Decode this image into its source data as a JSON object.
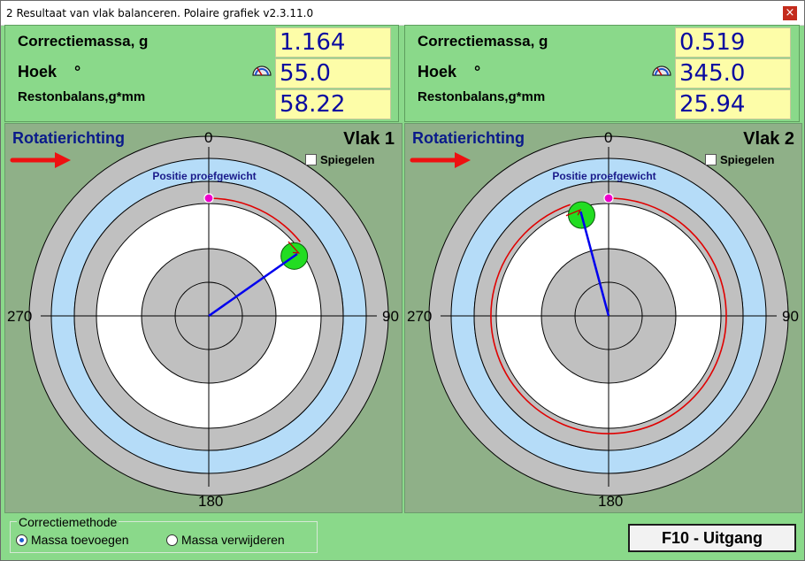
{
  "window": {
    "title": "2 Resultaat van vlak balanceren. Polaire grafiek v2.3.11.0",
    "close_glyph": "×"
  },
  "planes": [
    {
      "correctiemassa_label": "Correctiemassa, g",
      "correctiemassa_value": "1.164",
      "hoek_label": "Hoek",
      "degree_symbol": "°",
      "hoek_value": "55.0",
      "restonbalans_label": "Restonbalans,g*mm",
      "restonbalans_value": "58.22",
      "rotatie_label": "Rotatierichting",
      "vlak_label": "Vlak 1",
      "spiegelen_label": "Spiegelen",
      "spiegelen_checked": false,
      "positie_label": "Positie proefgewicht",
      "axis": {
        "top": "0",
        "right": "90",
        "bottom": "180",
        "left": "270"
      },
      "correction_angle_deg": 55.0,
      "trial_angle_deg": 0
    },
    {
      "correctiemassa_label": "Correctiemassa, g",
      "correctiemassa_value": "0.519",
      "hoek_label": "Hoek",
      "degree_symbol": "°",
      "hoek_value": "345.0",
      "restonbalans_label": "Restonbalans,g*mm",
      "restonbalans_value": "25.94",
      "rotatie_label": "Rotatierichting",
      "vlak_label": "Vlak 2",
      "spiegelen_label": "Spiegelen",
      "spiegelen_checked": false,
      "positie_label": "Positie proefgewicht",
      "axis": {
        "top": "0",
        "right": "90",
        "bottom": "180",
        "left": "270"
      },
      "correction_angle_deg": 345.0,
      "trial_angle_deg": 0
    }
  ],
  "method": {
    "legend": "Correctiemethode",
    "options": [
      "Massa toevoegen",
      "Massa verwijderen"
    ],
    "selected": "Massa toevoegen"
  },
  "exit_button": "F10 - Uitgang",
  "colors": {
    "panel_green": "#8ad98a",
    "plot_bg": "#8fb088",
    "ring_gray": "#c0c0c0",
    "ring_blue": "#b5dcf8",
    "ring_white": "#ffffff",
    "value_bg": "#fdfda8",
    "value_text": "#0a0aa0",
    "vector": "#0000ee",
    "arc": "#e00000",
    "weight": "#22dd22",
    "trial_marker": "#ee00cc"
  }
}
